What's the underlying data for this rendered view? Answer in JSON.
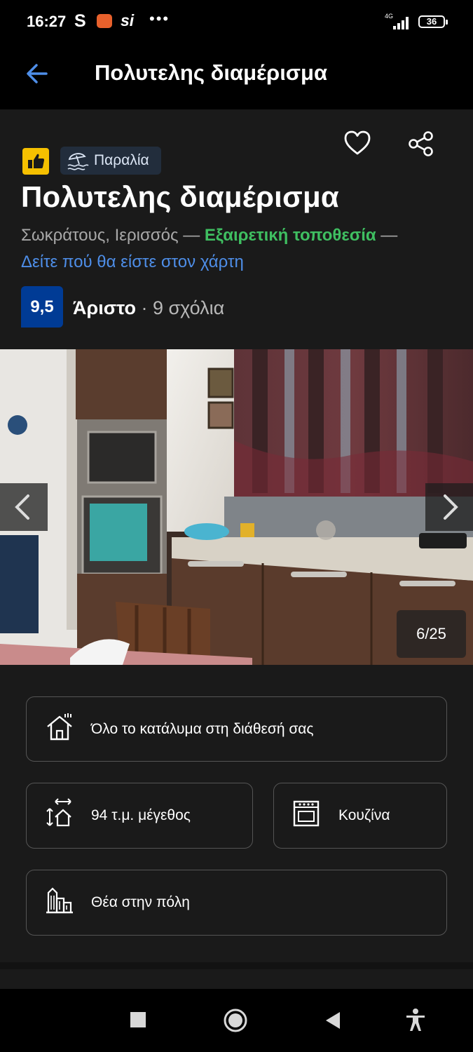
{
  "status_bar": {
    "time": "16:27",
    "s_label": "S",
    "si_label": "si",
    "more": "•••",
    "network": "4G",
    "battery": "36"
  },
  "header": {
    "title": "Πολυτελης διαμέρισμα",
    "back_icon": "arrow-left-icon"
  },
  "property": {
    "badge": "Παραλία",
    "name": "Πολυτελης διαμέρισμα",
    "address": "Σωκράτους, Ιερισσός",
    "dash": "—",
    "location_highlight": "Εξαιρετική τοποθεσία",
    "map_link": "Δείτε πού θα είστε στον χάρτη",
    "score": "9,5",
    "rating_word": "Άριστο",
    "reviews": "· 9 σχόλια"
  },
  "gallery": {
    "counter": "6/25"
  },
  "features": [
    {
      "label": "Όλο το κατάλυμα στη διάθεσή σας",
      "icon": "house-icon"
    },
    {
      "label": "94 τ.μ. μέγεθος",
      "icon": "size-icon"
    },
    {
      "label": "Κουζίνα",
      "icon": "kitchen-icon"
    },
    {
      "label": "Θέα στην πόλη",
      "icon": "city-icon"
    }
  ],
  "colors": {
    "accent_blue": "#003b95",
    "link_blue": "#4e8ee8",
    "highlight_green": "#3fbf61",
    "thumb_yellow": "#f5c000"
  }
}
